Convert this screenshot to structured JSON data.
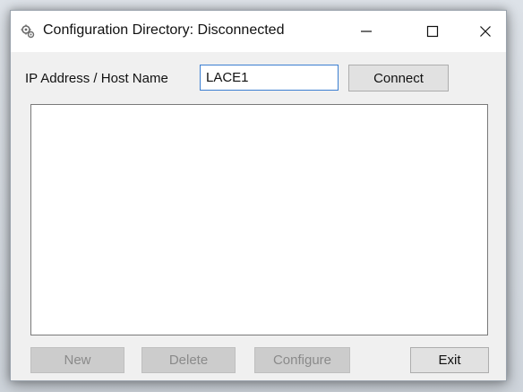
{
  "window": {
    "title": "Configuration Directory: Disconnected",
    "icon": "gears-icon",
    "controls": {
      "minimize": "minimize-icon",
      "maximize": "maximize-icon",
      "close": "close-icon"
    }
  },
  "connection": {
    "label": "IP Address / Host Name",
    "host_value": "LACE1",
    "connect_label": "Connect"
  },
  "list": {
    "items": []
  },
  "actions": {
    "new_label": "New",
    "delete_label": "Delete",
    "configure_label": "Configure",
    "exit_label": "Exit"
  },
  "colors": {
    "input_border_focus": "#3c7fd1",
    "button_face": "#e1e1e1",
    "disabled_text": "#8a8a8a"
  }
}
